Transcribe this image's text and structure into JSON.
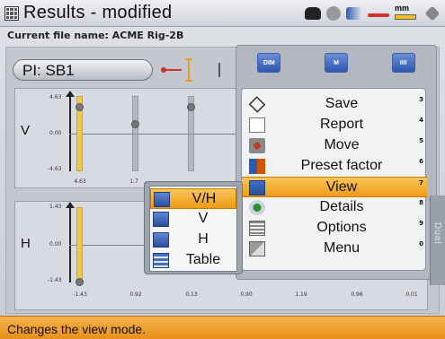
{
  "window": {
    "title": "Results - modified"
  },
  "header": {
    "file_label": "Current file name: ACME Rig-2B"
  },
  "status_icons": {
    "mm_unit": "mm"
  },
  "machine": {
    "selector_value": "PI: SB1"
  },
  "chart_v": {
    "axis_label": "V",
    "y_max": "4.63",
    "y_zero": "0.00",
    "y_min": "-4.63",
    "x_ticks": [
      "4.63",
      "1.7"
    ]
  },
  "chart_h": {
    "axis_label": "H",
    "y_max": "1.43",
    "y_zero": "0.00",
    "y_min": "-1.43",
    "x_ticks": [
      "-1.43",
      "0.92",
      "0.13",
      "0.90",
      "1.19",
      "0.96",
      "0.01"
    ]
  },
  "menu_tabs": [
    "DIM",
    "M",
    "IIII"
  ],
  "main_menu": {
    "items": [
      {
        "label": "Save",
        "shortcut": "3",
        "icon": "save-icon"
      },
      {
        "label": "Report",
        "shortcut": "4",
        "icon": "report-icon"
      },
      {
        "label": "Move",
        "shortcut": "5",
        "icon": "move-icon"
      },
      {
        "label": "Preset factor",
        "shortcut": "6",
        "icon": "preset-factor-icon"
      },
      {
        "label": "View",
        "shortcut": "7",
        "icon": "view-icon",
        "selected": true
      },
      {
        "label": "Details",
        "shortcut": "8",
        "icon": "details-icon"
      },
      {
        "label": "Options",
        "shortcut": "9",
        "icon": "options-icon"
      },
      {
        "label": "Menu",
        "shortcut": "0",
        "icon": "menu-icon"
      }
    ]
  },
  "view_submenu": {
    "items": [
      {
        "label": "V/H",
        "selected": true
      },
      {
        "label": "V"
      },
      {
        "label": "H"
      },
      {
        "label": "Table"
      }
    ]
  },
  "side_tab": {
    "label": "Dual"
  },
  "status_bar": {
    "message": "Changes the view mode."
  },
  "colors": {
    "highlight": "#f0a020",
    "accent_blue": "#2e56ad",
    "coupling_red": "#d03030"
  }
}
